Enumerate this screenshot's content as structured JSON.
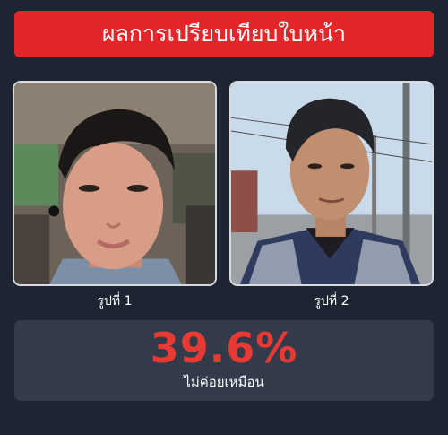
{
  "header": {
    "title": "ผลการเปรียบเทียบใบหน้า"
  },
  "photos": [
    {
      "caption": "รูปที่ 1"
    },
    {
      "caption": "รูปที่ 2"
    }
  ],
  "result": {
    "similarity": "39.6%",
    "verdict": "ไม่ค่อยเหมือน"
  },
  "colors": {
    "background": "#1e2532",
    "header": "#e3262a",
    "result_box": "#333b4b",
    "percent": "#e83a35"
  }
}
